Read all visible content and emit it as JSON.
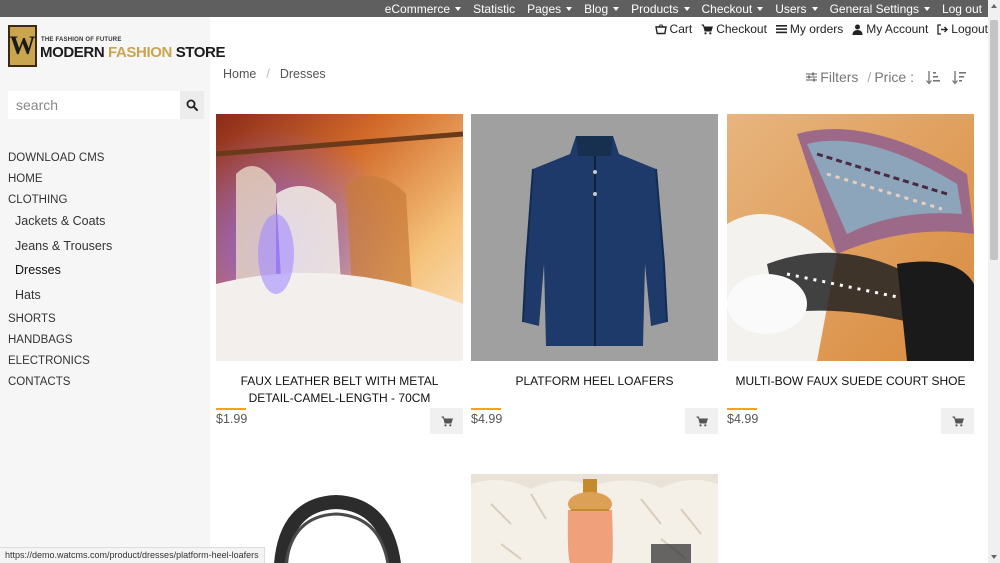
{
  "admin_bar": {
    "items": [
      {
        "label": "eCommerce",
        "dropdown": true
      },
      {
        "label": "Statistic",
        "dropdown": false
      },
      {
        "label": "Pages",
        "dropdown": true
      },
      {
        "label": "Blog",
        "dropdown": true
      },
      {
        "label": "Products",
        "dropdown": true
      },
      {
        "label": "Checkout",
        "dropdown": true
      },
      {
        "label": "Users",
        "dropdown": true
      },
      {
        "label": "General Settings",
        "dropdown": true
      },
      {
        "label": "Log out",
        "dropdown": false
      }
    ]
  },
  "user_bar": {
    "cart": "Cart",
    "checkout": "Checkout",
    "orders": "My orders",
    "account": "My Account",
    "logout": "Logout"
  },
  "logo": {
    "letter": "W",
    "tagline": "THE FASHION OF FUTURE",
    "name_part1": "MODERN ",
    "name_part2": "FASHION",
    "name_part3": " STORE"
  },
  "search": {
    "placeholder": "search",
    "value": ""
  },
  "categories": {
    "download_cms": "DOWNLOAD CMS",
    "home": "HOME",
    "clothing": "CLOTHING",
    "jackets": "Jackets & Coats",
    "jeans": "Jeans & Trousers",
    "dresses": "Dresses",
    "hats": "Hats",
    "shorts": "SHORTS",
    "handbags": "HANDBAGS",
    "electronics": "ELECTRONICS",
    "contacts": "CONTACTS"
  },
  "breadcrumb": {
    "home": "Home",
    "separator": "/",
    "current": "Dresses"
  },
  "toolbar": {
    "filters": "Filters",
    "price": "Price :",
    "slash": "/"
  },
  "products": [
    {
      "name": "FAUX LEATHER BELT WITH METAL DETAIL-CAMEL-LENGTH - 70CM",
      "price": "$1.99",
      "image": "clothes-rack-photo"
    },
    {
      "name": "PLATFORM HEEL LOAFERS",
      "price": "$4.99",
      "image": "navy-jacket-photo"
    },
    {
      "name": "MULTI-BOW FAUX SUEDE COURT SHOE",
      "price": "$4.99",
      "image": "folded-fabrics-photo"
    },
    {
      "name": "",
      "price": "",
      "image": "headphones-photo"
    },
    {
      "name": "",
      "price": "",
      "image": "perfume-on-fur-photo"
    }
  ],
  "status_url": "https://demo.watcms.com/product/dresses/platform-heel-loafers",
  "colors": {
    "admin_bar": "#5f5f5f",
    "sidebar": "#f6f6f6",
    "accent": "#f5a31a",
    "logo_gold": "#c9a550"
  }
}
